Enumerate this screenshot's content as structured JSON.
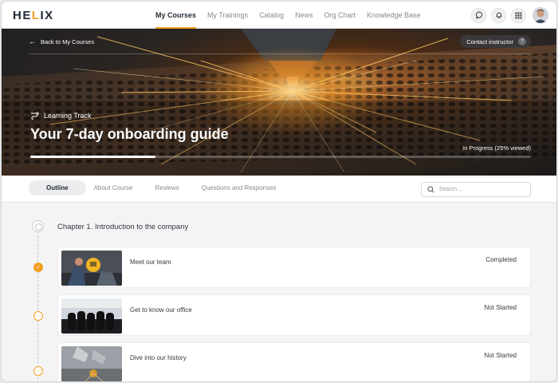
{
  "brand": {
    "logo_pre": "HE",
    "logo_accent": "L",
    "logo_post": "IX"
  },
  "nav": {
    "links": [
      {
        "label": "My Courses",
        "active": true
      },
      {
        "label": "My Trainings"
      },
      {
        "label": "Catalog"
      },
      {
        "label": "News"
      },
      {
        "label": "Org Chart"
      },
      {
        "label": "Knowledge Base"
      }
    ]
  },
  "hero": {
    "back_label": "Back to My Courses",
    "contact_label": "Contact instructor",
    "contact_help": "?",
    "track_label": "Learning Track",
    "title": "Your 7-day onboarding guide",
    "progress_label": "In Progress (25% viewed)",
    "progress_percent": 25
  },
  "tabs": [
    {
      "label": "Outline",
      "active": true
    },
    {
      "label": "About Course"
    },
    {
      "label": "Reviews"
    },
    {
      "label": "Questions and Responses"
    }
  ],
  "search": {
    "placeholder": "Search..."
  },
  "chapter": {
    "title": "Chapter 1. Introduction to the company",
    "lessons": [
      {
        "name": "Meet our team",
        "status": "Completed",
        "done": true
      },
      {
        "name": "Get to know our office",
        "status": "Not Started",
        "done": false
      },
      {
        "name": "Dive into our history",
        "status": "Not Started",
        "done": false
      }
    ]
  },
  "colors": {
    "accent": "#f0a020",
    "text_dark": "#1f2a36"
  },
  "icons": [
    "chat-icon",
    "bell-icon",
    "apps-grid-icon",
    "arrow-left-icon",
    "help-icon",
    "learning-track-icon",
    "search-icon",
    "check-icon",
    "more-icon"
  ]
}
